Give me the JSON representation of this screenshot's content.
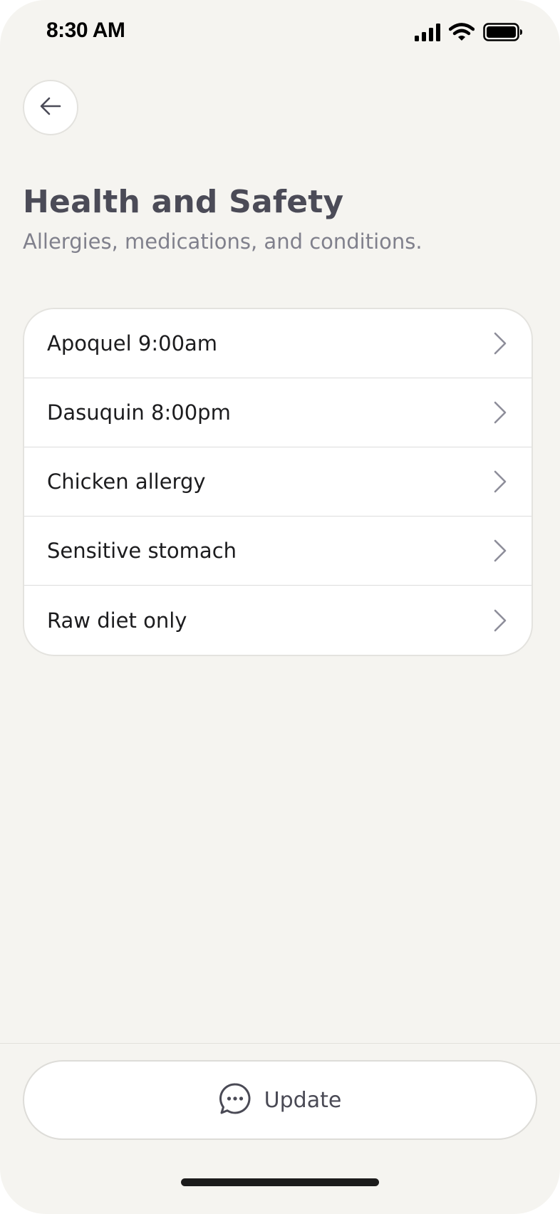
{
  "status_bar": {
    "time": "8:30 AM",
    "icons": [
      "cellular-signal-icon",
      "wifi-icon",
      "battery-icon"
    ]
  },
  "header": {
    "back_icon": "arrow-left-icon",
    "title": "Health and Safety",
    "subtitle": "Allergies, medications, and conditions."
  },
  "health_items": [
    {
      "label": "Apoquel 9:00am",
      "icon": "chevron-right-icon"
    },
    {
      "label": "Dasuquin 8:00pm",
      "icon": "chevron-right-icon"
    },
    {
      "label": "Chicken allergy",
      "icon": "chevron-right-icon"
    },
    {
      "label": "Sensitive stomach",
      "icon": "chevron-right-icon"
    },
    {
      "label": "Raw diet only",
      "icon": "chevron-right-icon"
    }
  ],
  "footer": {
    "update_label": "Update",
    "update_icon": "chat-bubble-icon"
  },
  "colors": {
    "background": "#f5f4f0",
    "card": "#ffffff",
    "title": "#4b4b57",
    "subtitle": "#80808c",
    "item_text": "#1c1c1e",
    "chevron": "#8e8e9a"
  }
}
